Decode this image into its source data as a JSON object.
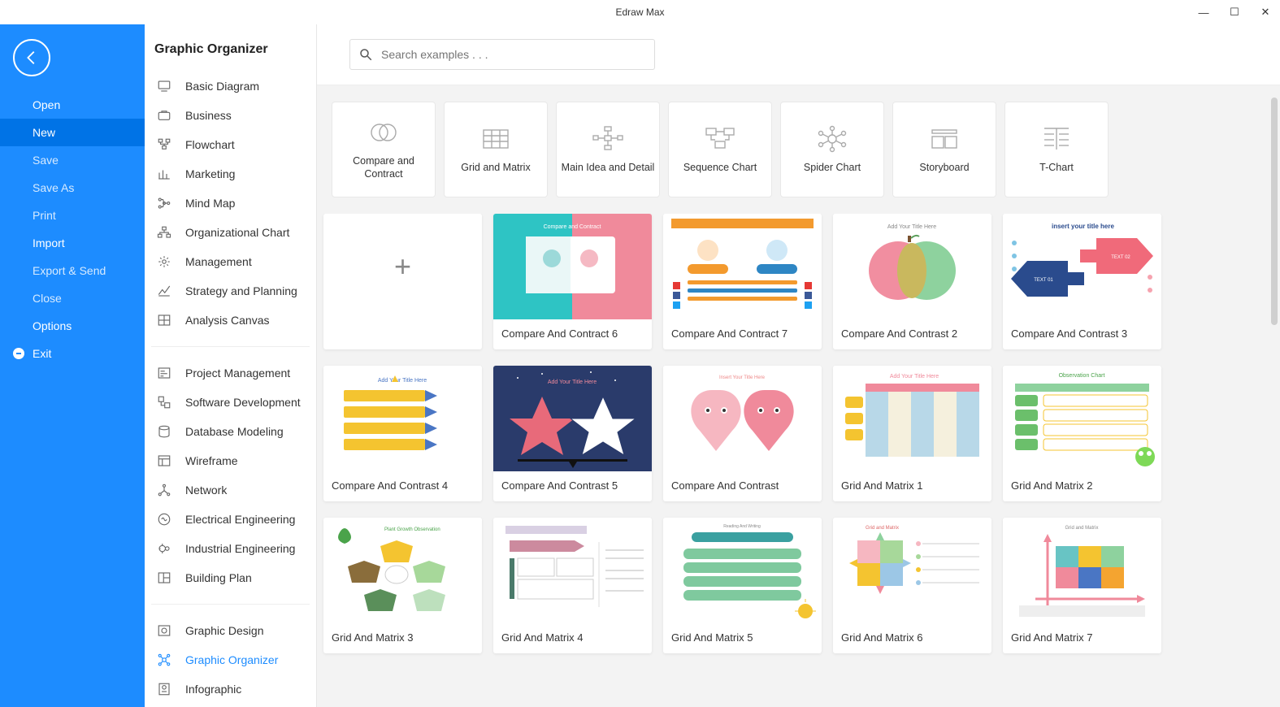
{
  "app_title": "Edraw Max",
  "window_controls": {
    "min": "—",
    "max": "☐",
    "close": "✕"
  },
  "sidebar": {
    "items": [
      {
        "label": "Open",
        "strong": true,
        "active": false
      },
      {
        "label": "New",
        "strong": true,
        "active": true
      },
      {
        "label": "Save",
        "strong": false,
        "active": false
      },
      {
        "label": "Save As",
        "strong": false,
        "active": false
      },
      {
        "label": "Print",
        "strong": false,
        "active": false
      },
      {
        "label": "Import",
        "strong": true,
        "active": false
      },
      {
        "label": "Export & Send",
        "strong": false,
        "active": false
      },
      {
        "label": "Close",
        "strong": false,
        "active": false
      },
      {
        "label": "Options",
        "strong": true,
        "active": false
      },
      {
        "label": "Exit",
        "strong": true,
        "active": false,
        "hasIcon": true
      }
    ]
  },
  "categories": {
    "title": "Graphic Organizer",
    "group1": [
      "Basic Diagram",
      "Business",
      "Flowchart",
      "Marketing",
      "Mind Map",
      "Organizational Chart",
      "Management",
      "Strategy and Planning",
      "Analysis Canvas"
    ],
    "group2": [
      "Project Management",
      "Software Development",
      "Database Modeling",
      "Wireframe",
      "Network",
      "Electrical Engineering",
      "Industrial Engineering",
      "Building Plan"
    ],
    "group3": [
      "Graphic Design",
      "Graphic Organizer",
      "Infographic"
    ],
    "activeLabel": "Graphic Organizer"
  },
  "search": {
    "placeholder": "Search examples . . ."
  },
  "types": [
    "Compare and Contract",
    "Grid and Matrix",
    "Main Idea and Detail",
    "Sequence Chart",
    "Spider Chart",
    "Storyboard",
    "T-Chart"
  ],
  "templates": [
    {
      "label": "",
      "blank": true
    },
    {
      "label": "Compare And Contract 6"
    },
    {
      "label": "Compare And Contract 7"
    },
    {
      "label": "Compare And Contrast 2"
    },
    {
      "label": "Compare And Contrast 3"
    },
    {
      "label": "Compare And Contrast 4"
    },
    {
      "label": "Compare And Contrast 5"
    },
    {
      "label": "Compare And Contrast"
    },
    {
      "label": "Grid And Matrix 1"
    },
    {
      "label": "Grid And Matrix 2"
    },
    {
      "label": "Grid And Matrix 3"
    },
    {
      "label": "Grid And Matrix 4"
    },
    {
      "label": "Grid And Matrix 5"
    },
    {
      "label": "Grid And Matrix 6"
    },
    {
      "label": "Grid And Matrix 7"
    }
  ]
}
